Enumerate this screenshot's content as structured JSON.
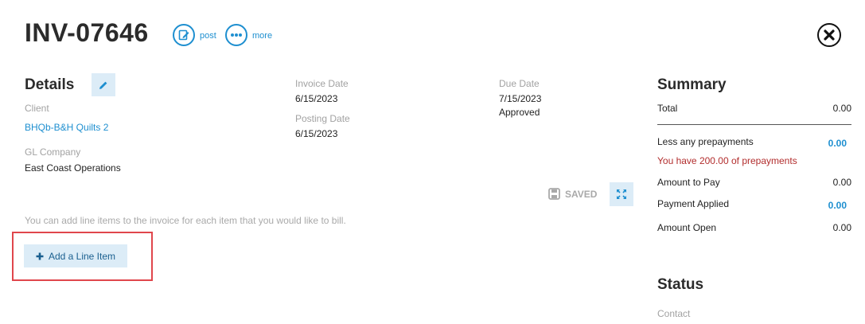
{
  "header": {
    "invoice_number": "INV-07646",
    "post_label": "post",
    "more_label": "more"
  },
  "details": {
    "title": "Details",
    "client_label": "Client",
    "client_value": "BHQb-B&H Quilts 2",
    "gl_company_label": "GL Company",
    "gl_company_value": "East Coast Operations",
    "invoice_date_label": "Invoice Date",
    "invoice_date_value": "6/15/2023",
    "posting_date_label": "Posting Date",
    "posting_date_value": "6/15/2023",
    "due_date_label": "Due Date",
    "due_date_value": "7/15/2023",
    "approval_status": "Approved"
  },
  "toolbar": {
    "saved_label": "SAVED"
  },
  "line_items": {
    "hint": "You can add line items to the invoice for each item that you would like to bill.",
    "add_button_label": "Add a Line Item"
  },
  "summary": {
    "title": "Summary",
    "total_label": "Total",
    "total_value": "0.00",
    "prepayments_label": "Less any prepayments",
    "prepayments_value": "0.00",
    "prepayments_note": "You have 200.00 of prepayments",
    "amount_to_pay_label": "Amount to Pay",
    "amount_to_pay_value": "0.00",
    "payment_applied_label": "Payment Applied",
    "payment_applied_value": "0.00",
    "amount_open_label": "Amount Open",
    "amount_open_value": "0.00"
  },
  "status": {
    "title": "Status",
    "contact_label": "Contact"
  },
  "colors": {
    "accent": "#1e8fd0",
    "button_bg": "#dcecf7",
    "highlight": "#e0464c",
    "warning_text": "#b22d2d"
  }
}
